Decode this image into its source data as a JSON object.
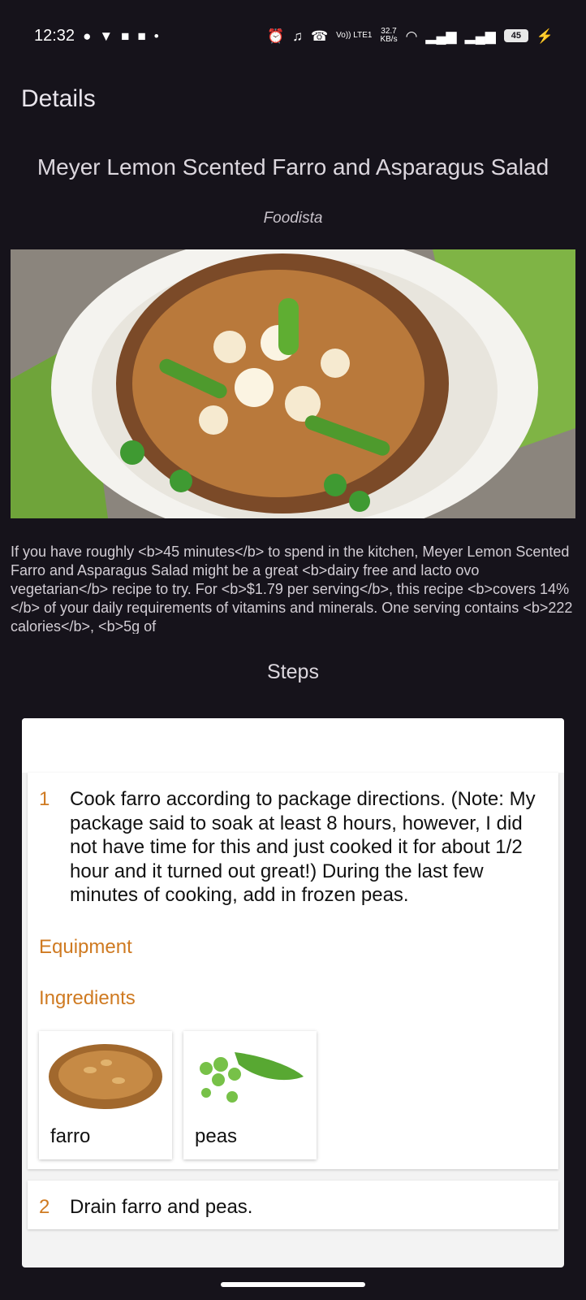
{
  "status_bar": {
    "time": "12:32",
    "network_volte": "Vo)) LTE1",
    "speed_value": "32.7",
    "speed_unit": "KB/s",
    "battery": "45",
    "icons": [
      "chat-bubble-icon",
      "shield-v-icon",
      "mail-icon",
      "linkedin-icon",
      "dot-icon",
      "alarm-icon",
      "bell-off-icon",
      "wifi-call-icon",
      "wifi-icon",
      "signal-icon",
      "signal-icon",
      "charging-icon"
    ]
  },
  "header": {
    "title": "Details"
  },
  "recipe": {
    "title": "Meyer Lemon Scented Farro and Asparagus Salad",
    "source": "Foodista",
    "summary": "If you have roughly <b>45 minutes</b> to spend in the kitchen, Meyer Lemon Scented Farro and Asparagus Salad might be a great <b>dairy free and lacto ovo vegetarian</b> recipe to try. For <b>$1.79 per serving</b>, this recipe <b>covers 14%</b> of your daily requirements of vitamins and minerals. One serving contains <b>222 calories</b>, <b>5g of"
  },
  "steps_section": {
    "title": "Steps",
    "steps": [
      {
        "number": "1",
        "text": "Cook farro according to package directions. (Note: My package said to soak at least 8 hours, however, I did not have time for this and just cooked it for about 1/2 hour and it turned out great!) During the last few minutes of cooking, add in frozen peas.",
        "equipment_label": "Equipment",
        "ingredients_label": "Ingredients",
        "ingredients": [
          {
            "name": "farro"
          },
          {
            "name": "peas"
          }
        ]
      },
      {
        "number": "2",
        "text": "Drain farro and peas."
      }
    ]
  },
  "colors": {
    "background": "#16131b",
    "accent": "#cf7a21",
    "card": "#ffffff"
  }
}
